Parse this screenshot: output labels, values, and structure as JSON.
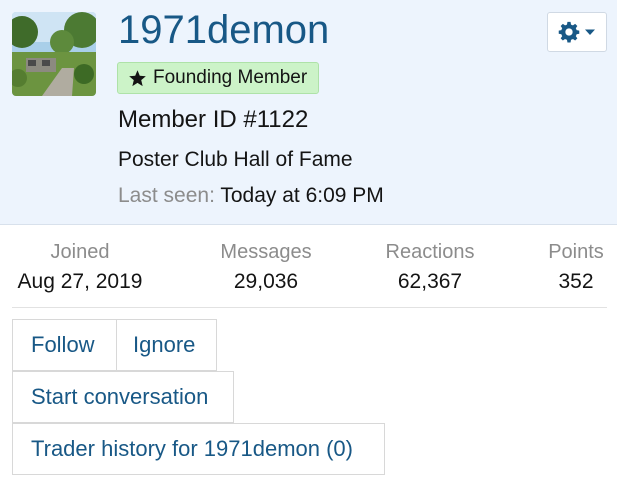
{
  "profile": {
    "username": "1971demon",
    "badge": "Founding Member",
    "member_id": "Member ID #1122",
    "title": "Poster Club Hall of Fame",
    "last_seen_label": "Last seen:",
    "last_seen_value": "Today at 6:09 PM",
    "avatar": "avatar"
  },
  "stats": [
    {
      "label": "Joined",
      "value": "Aug 27, 2019"
    },
    {
      "label": "Messages",
      "value": "29,036"
    },
    {
      "label": "Reactions",
      "value": "62,367"
    },
    {
      "label": "Points",
      "value": "352"
    }
  ],
  "actions": {
    "follow": "Follow",
    "ignore": "Ignore",
    "start_conversation": "Start conversation",
    "trader_history": "Trader history for 1971demon (0)"
  },
  "icons": {
    "gear": "gear-icon",
    "caret": "caret-down-icon",
    "star": "star-icon"
  },
  "colors": {
    "header_bg": "#edf4fd",
    "link": "#185886",
    "badge_bg": "#ccf3c8",
    "muted": "#8c8c8c"
  }
}
